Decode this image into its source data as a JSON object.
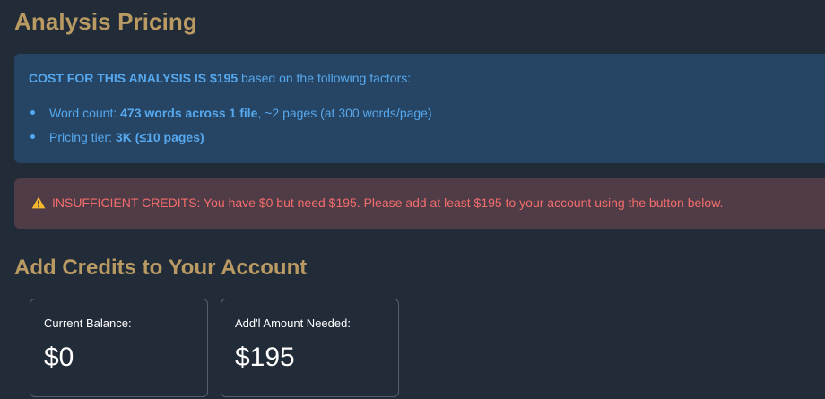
{
  "pricing": {
    "title": "Analysis Pricing",
    "cost_prefix": "COST FOR THIS ANALYSIS IS $195",
    "cost_suffix": " based on the following factors:",
    "word_count_label": "Word count: ",
    "word_count_value": "473 words across 1 file",
    "word_count_suffix": ", ~2 pages (at 300 words/page)",
    "tier_label": "Pricing tier: ",
    "tier_value": "3K (≤10 pages)"
  },
  "warning": {
    "icon": "warning-triangle-icon",
    "text": "INSUFFICIENT CREDITS: You have $0 but need $195. Please add at least $195 to your account using the button below."
  },
  "credits": {
    "title": "Add Credits to Your Account",
    "current_balance_label": "Current Balance:",
    "current_balance_value": "$0",
    "amount_needed_label": "Add'l Amount Needed:",
    "amount_needed_value": "$195"
  },
  "colors": {
    "background": "#222b38",
    "heading": "#b89a62",
    "info_bg": "#264564",
    "info_text": "#56a8ee",
    "warning_bg": "#4f3c46",
    "warning_text": "#f36d6d",
    "warning_icon": "#f5b82e"
  }
}
